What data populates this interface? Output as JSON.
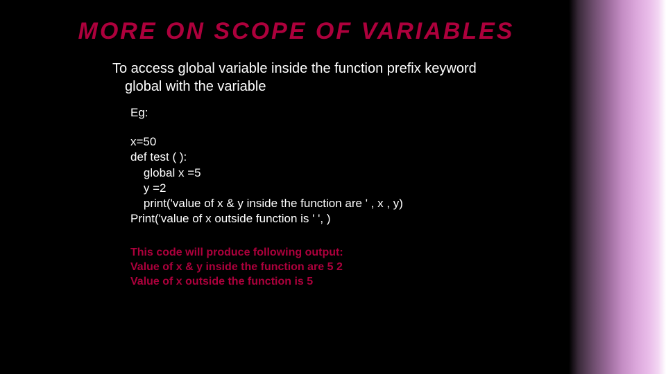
{
  "title": "MORE ON SCOPE OF VARIABLES",
  "intro": "To access global variable inside the function prefix keyword global with the variable",
  "eg_label": "Eg:",
  "code": "x=50\ndef test ( ):\n    global x =5\n    y =2\n    print('value of x & y inside the function are ' , x , y)\nPrint('value of x outside function is ' ', )",
  "output": "This code will produce following output:\nValue of x & y inside the function are 5  2\nValue of x outside the function is 5"
}
